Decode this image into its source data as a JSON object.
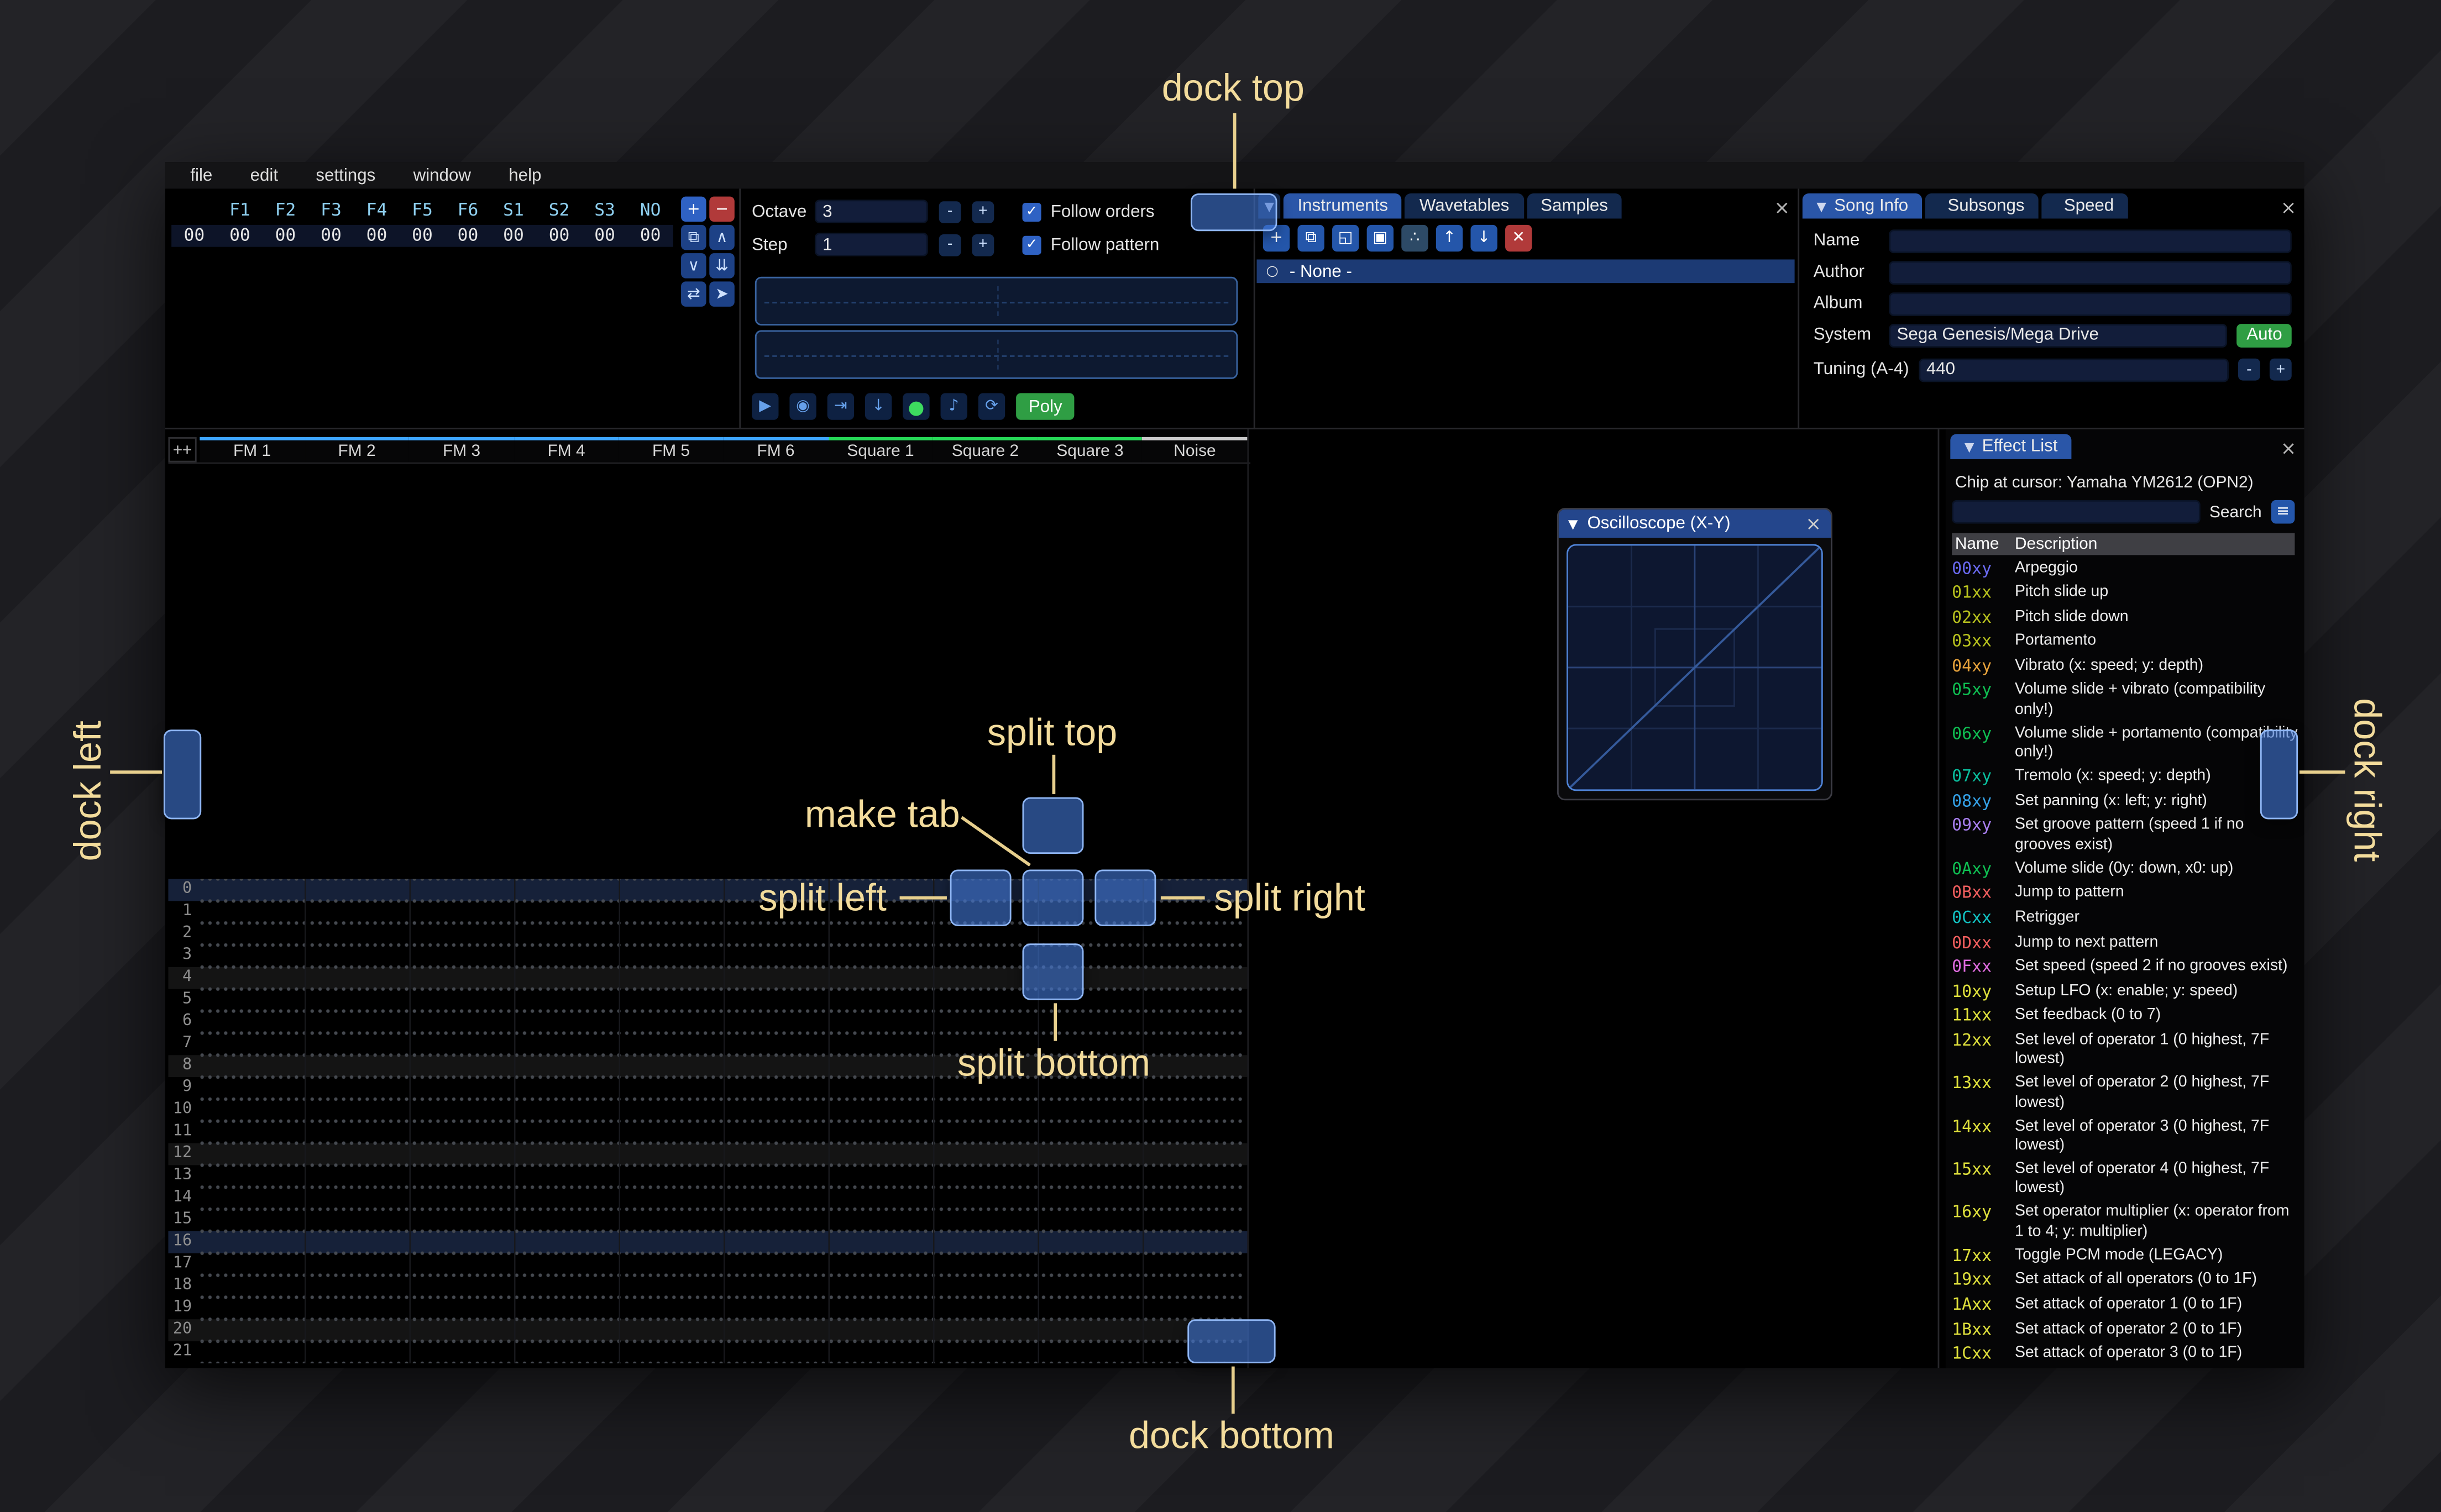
{
  "menu": {
    "items": [
      "file",
      "edit",
      "settings",
      "window",
      "help"
    ]
  },
  "icons": {
    "plus": "+",
    "minus": "−",
    "duplicate": "⧉",
    "move_up": "∧",
    "move_down": "∨",
    "duplicate_end": "⇊",
    "swap": "⇄",
    "cursor": "➤",
    "open": "◱",
    "save": "▣",
    "sitemap": "∴",
    "arrow_up": "↑",
    "arrow_down": "↓",
    "delete": "✕",
    "play": "▶",
    "play_pattern": "◉",
    "step_one": "⇥",
    "step_down": "↓",
    "record": "●",
    "metronome": "♪",
    "repeat": "⟳",
    "check": "✓",
    "collapse": "▼",
    "close": "×",
    "menu": "≡",
    "radio": "○",
    "tab_list": "▼"
  },
  "orders": {
    "headers": [
      "",
      "F1",
      "F2",
      "F3",
      "F4",
      "F5",
      "F6",
      "S1",
      "S2",
      "S3",
      "NO"
    ],
    "cells": [
      "00",
      "00",
      "00",
      "00",
      "00",
      "00",
      "00",
      "00",
      "00",
      "00",
      "00"
    ]
  },
  "controls": {
    "octave_label": "Octave",
    "octave_value": "3",
    "step_label": "Step",
    "step_value": "1",
    "minus": "-",
    "plus": "+",
    "follow_orders": "Follow orders",
    "follow_pattern": "Follow pattern",
    "poly": "Poly"
  },
  "instruments": {
    "tabs": [
      {
        "label": "Instruments",
        "cls": "active"
      },
      {
        "label": "Wavetables",
        "cls": ""
      },
      {
        "label": "Samples",
        "cls": ""
      }
    ],
    "none_item": "- None -"
  },
  "song_info": {
    "tabs": [
      {
        "label": "Song Info",
        "cls": "active",
        "arrow": "▼"
      },
      {
        "label": "Subsongs",
        "cls": ""
      },
      {
        "label": "Speed",
        "cls": ""
      }
    ],
    "name_label": "Name",
    "author_label": "Author",
    "album_label": "Album",
    "system_label": "System",
    "system_value": "Sega Genesis/Mega Drive",
    "auto_label": "Auto",
    "tuning_label": "Tuning (A-4)",
    "tuning_value": "440"
  },
  "pattern": {
    "corner": "++",
    "channels": [
      {
        "name": "FM 1",
        "color": "#3da5ff"
      },
      {
        "name": "FM 2",
        "color": "#3da5ff"
      },
      {
        "name": "FM 3",
        "color": "#3da5ff"
      },
      {
        "name": "FM 4",
        "color": "#3da5ff"
      },
      {
        "name": "FM 5",
        "color": "#3da5ff"
      },
      {
        "name": "FM 6",
        "color": "#3da5ff"
      },
      {
        "name": "Square 1",
        "color": "#27d857"
      },
      {
        "name": "Square 2",
        "color": "#27d857"
      },
      {
        "name": "Square 3",
        "color": "#27d857"
      },
      {
        "name": "Noise",
        "color": "#c8c8c8"
      }
    ],
    "rows": [
      {
        "n": "0",
        "hl": "hl2"
      },
      {
        "n": "1",
        "hl": ""
      },
      {
        "n": "2",
        "hl": ""
      },
      {
        "n": "3",
        "hl": ""
      },
      {
        "n": "4",
        "hl": "hl1"
      },
      {
        "n": "5",
        "hl": ""
      },
      {
        "n": "6",
        "hl": ""
      },
      {
        "n": "7",
        "hl": ""
      },
      {
        "n": "8",
        "hl": "hl1"
      },
      {
        "n": "9",
        "hl": ""
      },
      {
        "n": "10",
        "hl": ""
      },
      {
        "n": "11",
        "hl": ""
      },
      {
        "n": "12",
        "hl": "hl1"
      },
      {
        "n": "13",
        "hl": ""
      },
      {
        "n": "14",
        "hl": ""
      },
      {
        "n": "15",
        "hl": ""
      },
      {
        "n": "16",
        "hl": "hl2"
      },
      {
        "n": "17",
        "hl": ""
      },
      {
        "n": "18",
        "hl": ""
      },
      {
        "n": "19",
        "hl": ""
      },
      {
        "n": "20",
        "hl": "hl1"
      },
      {
        "n": "21",
        "hl": ""
      }
    ]
  },
  "oscilloscope": {
    "title": "Oscilloscope (X-Y)"
  },
  "effect_list": {
    "tab": "Effect List",
    "chip_line": "Chip at cursor: Yamaha YM2612 (OPN2)",
    "search_label": "Search",
    "columns": {
      "name": "Name",
      "description": "Description"
    },
    "effects": [
      {
        "code": "00xy",
        "desc": "Arpeggio",
        "color": "#6a6af0"
      },
      {
        "code": "01xx",
        "desc": "Pitch slide up",
        "color": "#b8c21e"
      },
      {
        "code": "02xx",
        "desc": "Pitch slide down",
        "color": "#b8c21e"
      },
      {
        "code": "03xx",
        "desc": "Portamento",
        "color": "#b8c21e"
      },
      {
        "code": "04xy",
        "desc": "Vibrato (x: speed; y: depth)",
        "color": "#e8a33c"
      },
      {
        "code": "05xy",
        "desc": "Volume slide + vibrato (compatibility only!)",
        "color": "#0fbe52"
      },
      {
        "code": "06xy",
        "desc": "Volume slide + portamento (compatibility only!)",
        "color": "#0fbe52"
      },
      {
        "code": "07xy",
        "desc": "Tremolo (x: speed; y: depth)",
        "color": "#0abf9e"
      },
      {
        "code": "08xy",
        "desc": "Set panning (x: left; y: right)",
        "color": "#35a2e8"
      },
      {
        "code": "09xy",
        "desc": "Set groove pattern (speed 1 if no grooves exist)",
        "color": "#a87ff0"
      },
      {
        "code": "0Axy",
        "desc": "Volume slide (0y: down, x0: up)",
        "color": "#0fbe52"
      },
      {
        "code": "0Bxx",
        "desc": "Jump to pattern",
        "color": "#f25f5f"
      },
      {
        "code": "0Cxx",
        "desc": "Retrigger",
        "color": "#12c2c2"
      },
      {
        "code": "0Dxx",
        "desc": "Jump to next pattern",
        "color": "#f25f5f"
      },
      {
        "code": "0Fxx",
        "desc": "Set speed (speed 2 if no grooves exist)",
        "color": "#e06ce0"
      },
      {
        "code": "10xy",
        "desc": "Setup LFO (x: enable; y: speed)",
        "color": "#dfe03c"
      },
      {
        "code": "11xx",
        "desc": "Set feedback (0 to 7)",
        "color": "#dfe03c"
      },
      {
        "code": "12xx",
        "desc": "Set level of operator 1 (0 highest, 7F lowest)",
        "color": "#dfe03c"
      },
      {
        "code": "13xx",
        "desc": "Set level of operator 2 (0 highest, 7F lowest)",
        "color": "#dfe03c"
      },
      {
        "code": "14xx",
        "desc": "Set level of operator 3 (0 highest, 7F lowest)",
        "color": "#dfe03c"
      },
      {
        "code": "15xx",
        "desc": "Set level of operator 4 (0 highest, 7F lowest)",
        "color": "#dfe03c"
      },
      {
        "code": "16xy",
        "desc": "Set operator multiplier (x: operator from 1 to 4; y: multiplier)",
        "color": "#dfe03c"
      },
      {
        "code": "17xx",
        "desc": "Toggle PCM mode (LEGACY)",
        "color": "#dfe03c"
      },
      {
        "code": "19xx",
        "desc": "Set attack of all operators (0 to 1F)",
        "color": "#dfe03c"
      },
      {
        "code": "1Axx",
        "desc": "Set attack of operator 1 (0 to 1F)",
        "color": "#dfe03c"
      },
      {
        "code": "1Bxx",
        "desc": "Set attack of operator 2 (0 to 1F)",
        "color": "#dfe03c"
      },
      {
        "code": "1Cxx",
        "desc": "Set attack of operator 3 (0 to 1F)",
        "color": "#dfe03c"
      }
    ]
  },
  "annotations": {
    "dock_top": "dock top",
    "dock_bottom": "dock bottom",
    "dock_left": "dock left",
    "dock_right": "dock right",
    "split_top": "split top",
    "split_bottom": "split bottom",
    "split_left": "split left",
    "split_right": "split right",
    "make_tab": "make tab"
  },
  "colors": {
    "accent_tab": "#2a56a8",
    "drop_target": "#4076d4",
    "annotation": "#f3dc9c",
    "auto_green": "#2f9e44",
    "record_green": "#3ddc5f",
    "fm_channel": "#3da5ff",
    "square_channel": "#27d857",
    "noise_channel": "#c8c8c8"
  }
}
